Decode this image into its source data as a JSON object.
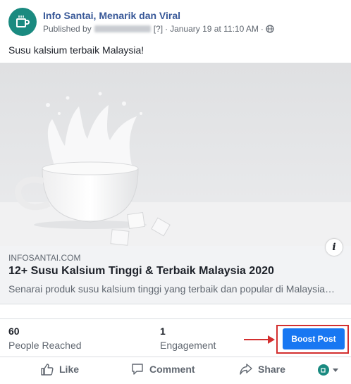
{
  "post": {
    "page_name": "Info Santai, Menarik dan Viral",
    "published_prefix": "Published by",
    "help_marker": "[?]",
    "separator": "·",
    "date": "January 19 at 11:10 AM",
    "message": "Susu kalsium terbaik Malaysia!"
  },
  "link_preview": {
    "domain": "INFOSANTAI.COM",
    "title": "12+ Susu Kalsium Tinggi & Terbaik Malaysia 2020",
    "description": "Senarai produk susu kalsium tinggi yang terbaik dan popular di Malaysia…",
    "info_glyph": "i"
  },
  "insights": {
    "reach_value": "60",
    "reach_label": "People Reached",
    "engagement_value": "1",
    "engagement_label": "Engagement",
    "boost_label": "Boost Post"
  },
  "actions": {
    "like": "Like",
    "comment": "Comment",
    "share": "Share"
  },
  "colors": {
    "brand_blue": "#1877f2",
    "page_name": "#385898",
    "avatar": "#1a8a80",
    "highlight": "#d32f2f"
  },
  "icons": {
    "avatar": "mug-icon",
    "privacy": "globe-icon",
    "like": "thumbs-up-icon",
    "comment": "speech-bubble-icon",
    "share": "share-arrow-icon",
    "audience": "audience-selector-icon"
  }
}
